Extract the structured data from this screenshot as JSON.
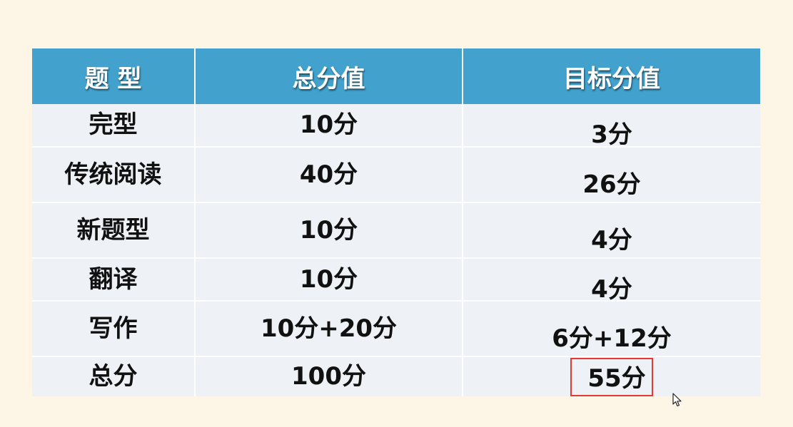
{
  "table": {
    "headers": [
      "题 型",
      "总分值",
      "目标分值"
    ],
    "rows": [
      {
        "type": "完型",
        "total": "10分",
        "target": "3分"
      },
      {
        "type": "传统阅读",
        "total": "40分",
        "target": "26分"
      },
      {
        "type": "新题型",
        "total": "10分",
        "target": "4分"
      },
      {
        "type": "翻译",
        "total": "10分",
        "target": "4分"
      },
      {
        "type": "写作",
        "total": "10分+20分",
        "target": "6分+12分"
      },
      {
        "type": "总分",
        "total": "100分",
        "target": "55分",
        "highlighted": true
      }
    ]
  },
  "colors": {
    "page_background": "#fdf5e6",
    "header_background": "#42a2cd",
    "row_background": "#eef2f6",
    "highlight_border": "#e53935"
  },
  "icons": {
    "cursor": "mouse-pointer-icon"
  }
}
